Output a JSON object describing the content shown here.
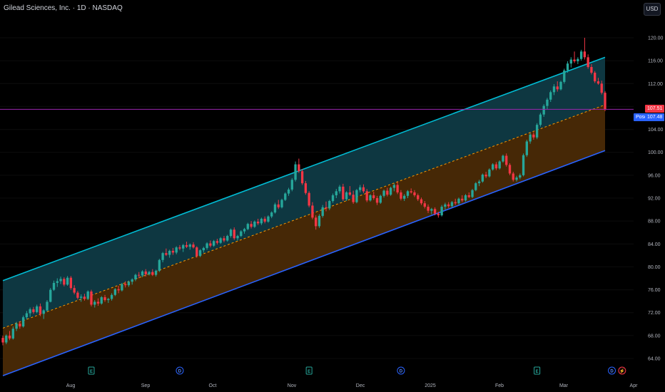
{
  "header": {
    "title": "Gilead Sciences, Inc. · 1D · NASDAQ",
    "currency": "USD"
  },
  "colors": {
    "background": "#000000",
    "up": "#26a69a",
    "down": "#f23645",
    "channel_upper": "#00bcd4",
    "channel_lower": "#2962ff",
    "channel_mid": "#ff9800",
    "upper_fill": "#0f3a44",
    "lower_fill": "#4a2a06",
    "price_line": "#9c27b0",
    "pos_label": "#2962ff",
    "last_price_label": "#f23645"
  },
  "price_labels": {
    "last": "107.51",
    "pos_tag": "Posc",
    "pos_value": "107.48"
  },
  "chart_data": {
    "type": "candlestick",
    "title": "Gilead Sciences, Inc. · 1D · NASDAQ",
    "ylim": [
      62,
      122
    ],
    "y_ticks": [
      "64.00",
      "68.00",
      "72.00",
      "76.00",
      "80.00",
      "84.00",
      "88.00",
      "92.00",
      "96.00",
      "100.00",
      "104.00",
      "108.00",
      "112.00",
      "116.00",
      "120.00"
    ],
    "x_ticks": [
      "Aug",
      "Sep",
      "Oct",
      "Nov",
      "Dec",
      "2025",
      "Feb",
      "Mar",
      "Apr"
    ],
    "last_price": 107.51,
    "regression_channel": {
      "upper": {
        "start": 77.6,
        "end": 116.6
      },
      "mid": {
        "start": 69.3,
        "end": 108.3
      },
      "lower": {
        "start": 61.0,
        "end": 100.3
      }
    },
    "events": [
      {
        "type": "earnings",
        "label": "E",
        "x_index": 26
      },
      {
        "type": "dividend",
        "label": "D",
        "x_index": 52
      },
      {
        "type": "earnings",
        "label": "E",
        "x_index": 90
      },
      {
        "type": "dividend",
        "label": "D",
        "x_index": 117
      },
      {
        "type": "earnings",
        "label": "E",
        "x_index": 157
      },
      {
        "type": "dividend",
        "label": "D",
        "x_index": 179
      },
      {
        "type": "split",
        "label": "⚡",
        "x_index": 182
      }
    ],
    "candles": [
      [
        67.6,
        68.0,
        66.3,
        66.8
      ],
      [
        66.8,
        68.2,
        66.5,
        68.0
      ],
      [
        68.0,
        68.8,
        67.2,
        67.5
      ],
      [
        67.5,
        69.6,
        67.3,
        69.2
      ],
      [
        69.2,
        70.4,
        68.8,
        70.1
      ],
      [
        70.1,
        70.5,
        69.2,
        69.6
      ],
      [
        69.6,
        71.5,
        69.4,
        71.2
      ],
      [
        71.2,
        72.3,
        70.8,
        71.9
      ],
      [
        71.9,
        72.9,
        71.3,
        72.6
      ],
      [
        72.6,
        73.0,
        71.8,
        72.1
      ],
      [
        72.1,
        73.4,
        71.9,
        73.1
      ],
      [
        73.1,
        73.6,
        71.4,
        71.8
      ],
      [
        71.8,
        72.6,
        70.9,
        72.4
      ],
      [
        72.4,
        74.2,
        72.2,
        73.9
      ],
      [
        73.9,
        76.3,
        73.8,
        76.0
      ],
      [
        76.0,
        77.6,
        75.8,
        77.2
      ],
      [
        77.2,
        78.0,
        76.5,
        77.5
      ],
      [
        77.5,
        78.3,
        77.0,
        77.9
      ],
      [
        77.9,
        78.2,
        76.6,
        76.9
      ],
      [
        76.9,
        78.4,
        76.7,
        78.1
      ],
      [
        78.1,
        78.4,
        76.0,
        76.3
      ],
      [
        76.3,
        76.8,
        75.2,
        75.5
      ],
      [
        75.5,
        75.8,
        74.3,
        74.6
      ],
      [
        74.6,
        75.2,
        73.9,
        74.8
      ],
      [
        74.8,
        75.3,
        74.1,
        74.4
      ],
      [
        74.4,
        75.9,
        74.2,
        75.7
      ],
      [
        75.7,
        76.0,
        73.1,
        73.4
      ],
      [
        73.4,
        74.2,
        72.9,
        73.9
      ],
      [
        73.9,
        74.5,
        73.2,
        73.6
      ],
      [
        73.6,
        74.9,
        73.4,
        74.7
      ],
      [
        74.7,
        75.1,
        73.9,
        74.2
      ],
      [
        74.2,
        74.6,
        73.7,
        74.4
      ],
      [
        74.4,
        75.4,
        74.1,
        75.1
      ],
      [
        75.1,
        76.3,
        74.9,
        76.1
      ],
      [
        76.1,
        76.7,
        75.4,
        75.9
      ],
      [
        75.9,
        77.2,
        75.7,
        77.0
      ],
      [
        77.0,
        77.5,
        76.4,
        76.8
      ],
      [
        76.8,
        77.6,
        76.5,
        77.4
      ],
      [
        77.4,
        78.0,
        76.9,
        77.8
      ],
      [
        77.8,
        78.8,
        77.5,
        78.6
      ],
      [
        78.6,
        79.1,
        78.0,
        78.5
      ],
      [
        78.5,
        79.4,
        78.2,
        79.2
      ],
      [
        79.2,
        79.6,
        78.3,
        78.7
      ],
      [
        78.7,
        79.3,
        78.5,
        79.1
      ],
      [
        79.1,
        79.6,
        78.4,
        78.6
      ],
      [
        78.6,
        79.5,
        78.3,
        79.3
      ],
      [
        79.3,
        81.4,
        79.1,
        81.2
      ],
      [
        81.2,
        82.6,
        80.8,
        82.4
      ],
      [
        82.4,
        83.2,
        81.9,
        82.1
      ],
      [
        82.1,
        83.0,
        81.6,
        82.8
      ],
      [
        82.8,
        83.3,
        82.1,
        82.5
      ],
      [
        82.5,
        83.6,
        82.2,
        83.4
      ],
      [
        83.4,
        83.8,
        82.9,
        83.2
      ],
      [
        83.2,
        84.0,
        82.6,
        83.8
      ],
      [
        83.8,
        84.4,
        83.3,
        83.5
      ],
      [
        83.5,
        84.1,
        83.0,
        83.9
      ],
      [
        83.9,
        84.3,
        83.2,
        83.4
      ],
      [
        83.4,
        83.6,
        81.6,
        81.9
      ],
      [
        81.9,
        83.1,
        81.7,
        82.9
      ],
      [
        82.9,
        83.5,
        82.5,
        83.3
      ],
      [
        83.3,
        84.3,
        83.0,
        84.1
      ],
      [
        84.1,
        84.6,
        83.4,
        83.7
      ],
      [
        83.7,
        84.7,
        83.5,
        84.5
      ],
      [
        84.5,
        84.9,
        83.9,
        84.2
      ],
      [
        84.2,
        85.2,
        84.0,
        85.0
      ],
      [
        85.0,
        85.4,
        84.3,
        84.6
      ],
      [
        84.6,
        85.6,
        84.4,
        85.4
      ],
      [
        85.4,
        86.7,
        85.1,
        86.5
      ],
      [
        86.5,
        86.9,
        84.7,
        85.0
      ],
      [
        85.0,
        85.6,
        84.6,
        85.4
      ],
      [
        85.4,
        86.4,
        85.2,
        86.2
      ],
      [
        86.2,
        86.8,
        85.8,
        86.6
      ],
      [
        86.6,
        87.7,
        86.4,
        87.5
      ],
      [
        87.5,
        88.0,
        86.7,
        87.0
      ],
      [
        87.0,
        88.1,
        86.8,
        87.9
      ],
      [
        87.9,
        88.4,
        87.3,
        87.6
      ],
      [
        87.6,
        88.6,
        87.3,
        88.4
      ],
      [
        88.4,
        88.8,
        87.6,
        87.9
      ],
      [
        87.9,
        89.0,
        87.7,
        88.8
      ],
      [
        88.8,
        89.7,
        88.5,
        89.5
      ],
      [
        89.5,
        91.2,
        89.3,
        90.9
      ],
      [
        90.9,
        91.7,
        90.1,
        90.4
      ],
      [
        90.4,
        91.9,
        90.2,
        91.7
      ],
      [
        91.7,
        93.0,
        91.5,
        92.8
      ],
      [
        92.8,
        93.8,
        92.4,
        93.5
      ],
      [
        93.5,
        95.5,
        93.2,
        95.2
      ],
      [
        95.2,
        98.4,
        94.9,
        97.9
      ],
      [
        97.9,
        98.9,
        96.4,
        96.7
      ],
      [
        96.7,
        97.1,
        94.3,
        94.6
      ],
      [
        94.6,
        95.0,
        92.6,
        92.9
      ],
      [
        92.9,
        93.2,
        90.4,
        90.7
      ],
      [
        90.7,
        91.3,
        88.3,
        88.6
      ],
      [
        88.6,
        89.0,
        86.5,
        87.1
      ],
      [
        87.1,
        89.2,
        86.8,
        88.9
      ],
      [
        88.9,
        90.8,
        88.6,
        90.4
      ],
      [
        90.4,
        91.4,
        89.7,
        90.2
      ],
      [
        90.2,
        91.7,
        89.9,
        91.5
      ],
      [
        91.5,
        92.8,
        91.2,
        92.5
      ],
      [
        92.5,
        93.6,
        92.0,
        93.2
      ],
      [
        93.2,
        94.3,
        92.8,
        94.0
      ],
      [
        94.0,
        94.5,
        91.5,
        91.8
      ],
      [
        91.8,
        93.2,
        91.5,
        93.0
      ],
      [
        93.0,
        94.1,
        92.4,
        92.6
      ],
      [
        92.6,
        93.3,
        91.0,
        91.3
      ],
      [
        91.3,
        93.6,
        91.1,
        93.4
      ],
      [
        93.4,
        94.3,
        93.0,
        93.9
      ],
      [
        93.9,
        94.4,
        92.9,
        93.2
      ],
      [
        93.2,
        93.6,
        91.3,
        91.6
      ],
      [
        91.6,
        92.7,
        91.4,
        92.5
      ],
      [
        92.5,
        93.1,
        91.7,
        92.0
      ],
      [
        92.0,
        92.4,
        90.8,
        91.2
      ],
      [
        91.2,
        92.6,
        91.0,
        92.4
      ],
      [
        92.4,
        93.5,
        92.1,
        93.3
      ],
      [
        93.3,
        93.8,
        92.3,
        92.6
      ],
      [
        92.6,
        94.0,
        92.4,
        93.8
      ],
      [
        93.8,
        94.6,
        93.2,
        94.3
      ],
      [
        94.3,
        94.8,
        92.7,
        93.0
      ],
      [
        93.0,
        93.4,
        91.6,
        91.9
      ],
      [
        91.9,
        92.7,
        91.5,
        92.4
      ],
      [
        92.4,
        93.4,
        92.0,
        93.2
      ],
      [
        93.2,
        93.7,
        92.8,
        93.0
      ],
      [
        93.0,
        93.4,
        92.2,
        92.5
      ],
      [
        92.5,
        92.8,
        91.5,
        91.8
      ],
      [
        91.8,
        92.1,
        90.8,
        91.1
      ],
      [
        91.1,
        91.5,
        90.2,
        90.5
      ],
      [
        90.5,
        90.9,
        89.4,
        89.8
      ],
      [
        89.8,
        90.3,
        89.2,
        90.1
      ],
      [
        90.1,
        90.4,
        89.0,
        89.3
      ],
      [
        89.3,
        89.6,
        88.6,
        89.0
      ],
      [
        89.0,
        90.8,
        88.8,
        90.5
      ],
      [
        90.5,
        91.2,
        90.0,
        90.9
      ],
      [
        90.9,
        91.3,
        90.3,
        90.6
      ],
      [
        90.6,
        91.5,
        90.4,
        91.3
      ],
      [
        91.3,
        91.9,
        90.8,
        91.1
      ],
      [
        91.1,
        92.1,
        90.9,
        91.9
      ],
      [
        91.9,
        92.5,
        91.3,
        91.6
      ],
      [
        91.6,
        92.7,
        91.4,
        92.5
      ],
      [
        92.5,
        93.0,
        92.0,
        92.2
      ],
      [
        92.2,
        93.6,
        92.0,
        93.4
      ],
      [
        93.4,
        94.8,
        93.2,
        94.6
      ],
      [
        94.6,
        95.2,
        94.1,
        94.9
      ],
      [
        94.9,
        96.3,
        94.7,
        96.1
      ],
      [
        96.1,
        96.6,
        95.5,
        95.8
      ],
      [
        95.8,
        97.2,
        95.6,
        97.0
      ],
      [
        97.0,
        98.1,
        96.8,
        97.9
      ],
      [
        97.9,
        98.3,
        96.9,
        97.2
      ],
      [
        97.2,
        98.6,
        97.0,
        98.4
      ],
      [
        98.4,
        99.6,
        98.2,
        99.4
      ],
      [
        99.4,
        99.8,
        97.5,
        97.8
      ],
      [
        97.8,
        98.1,
        96.0,
        96.3
      ],
      [
        96.3,
        96.6,
        94.9,
        95.2
      ],
      [
        95.2,
        95.9,
        94.9,
        95.6
      ],
      [
        95.6,
        96.3,
        95.3,
        96.0
      ],
      [
        96.0,
        99.8,
        95.8,
        99.5
      ],
      [
        99.5,
        102.2,
        99.2,
        101.9
      ],
      [
        101.9,
        103.4,
        101.5,
        103.1
      ],
      [
        103.1,
        103.5,
        102.2,
        102.6
      ],
      [
        102.6,
        105.1,
        102.3,
        104.8
      ],
      [
        104.8,
        106.9,
        104.5,
        106.6
      ],
      [
        106.6,
        108.4,
        106.2,
        108.1
      ],
      [
        108.1,
        109.5,
        107.5,
        109.2
      ],
      [
        109.2,
        110.8,
        108.8,
        110.5
      ],
      [
        110.5,
        111.9,
        110.0,
        111.5
      ],
      [
        111.5,
        112.4,
        110.6,
        111.0
      ],
      [
        111.0,
        112.5,
        110.8,
        112.3
      ],
      [
        112.3,
        114.6,
        112.0,
        114.3
      ],
      [
        114.3,
        115.9,
        113.9,
        115.5
      ],
      [
        115.5,
        116.6,
        114.8,
        116.2
      ],
      [
        116.2,
        117.6,
        115.6,
        115.9
      ],
      [
        115.9,
        116.6,
        115.4,
        116.3
      ],
      [
        116.3,
        117.9,
        116.0,
        117.6
      ],
      [
        117.6,
        120.0,
        116.2,
        116.6
      ],
      [
        116.6,
        117.1,
        114.6,
        114.9
      ],
      [
        114.9,
        115.4,
        113.6,
        113.9
      ],
      [
        113.9,
        114.2,
        112.1,
        112.4
      ],
      [
        112.4,
        113.0,
        111.8,
        112.0
      ],
      [
        112.0,
        112.5,
        110.1,
        110.4
      ],
      [
        110.4,
        110.7,
        107.2,
        107.51
      ]
    ]
  }
}
